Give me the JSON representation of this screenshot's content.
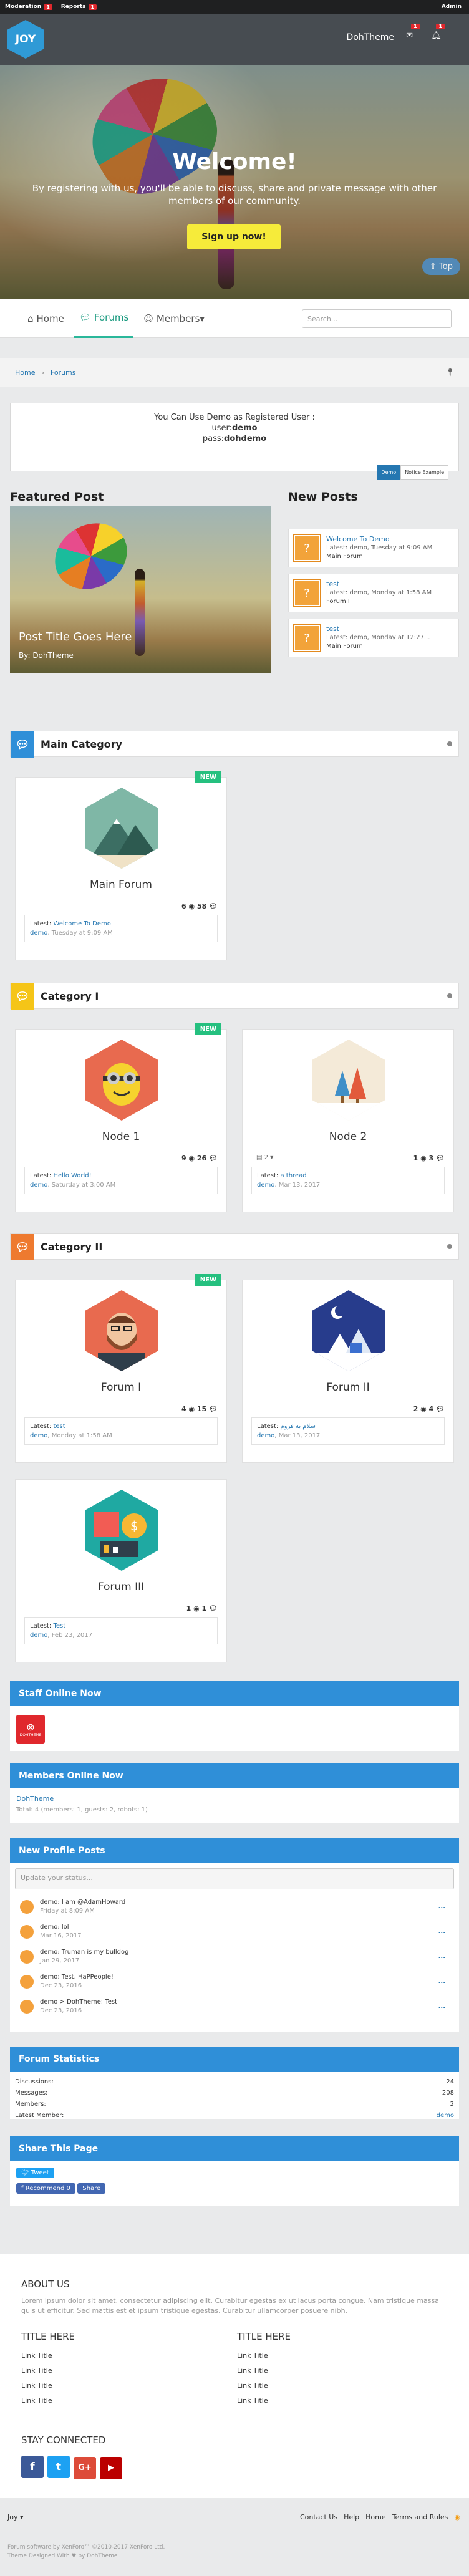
{
  "topbar": {
    "moderation": "Moderation",
    "moderation_count": "1",
    "reports": "Reports",
    "reports_count": "1",
    "admin": "Admin"
  },
  "header": {
    "logo": "JOY",
    "site_name": "DohTheme",
    "inbox_count": "1",
    "alerts_count": "1"
  },
  "hero": {
    "title": "Welcome!",
    "text": "By registering with us, you'll be able to discuss, share and private message with other members of our community.",
    "button": "Sign up now!",
    "top": "Top"
  },
  "nav": {
    "home": "Home",
    "forums": "Forums",
    "members": "Members",
    "search_placeholder": "Search..."
  },
  "breadcrumb": {
    "home": "Home",
    "forums": "Forums"
  },
  "notice": {
    "line1": "You Can Use Demo as Registered User :",
    "line2_label": "user:",
    "line2_value": "demo",
    "line3_label": "pass:",
    "line3_value": "dohdemo",
    "tag1": "Demo",
    "tag2": "Notice Example"
  },
  "featured": {
    "heading": "Featured Post",
    "title": "Post Title Goes Here",
    "author": "By: DohTheme"
  },
  "new_posts": {
    "heading": "New Posts",
    "items": [
      {
        "title": "Welcome To Demo",
        "latest": "Latest: demo, Tuesday at 9:09 AM",
        "forum": "Main Forum"
      },
      {
        "title": "test",
        "latest": "Latest: demo, Monday at 1:58 AM",
        "forum": "Forum I"
      },
      {
        "title": "test",
        "latest": "Latest: demo, Monday at 12:27...",
        "forum": "Main Forum"
      }
    ]
  },
  "categories": [
    {
      "name": "Main Category",
      "color": "#2f8fd8"
    },
    {
      "name": "Category I",
      "color": "#f5c518"
    },
    {
      "name": "Category II",
      "color": "#ee7a2f"
    }
  ],
  "forums": {
    "main": {
      "badge": "NEW",
      "name": "Main Forum",
      "threads": "6",
      "posts": "58",
      "latest_label": "Latest:",
      "latest_title": "Welcome To Demo",
      "user": "demo",
      "date": "Tuesday at 9:09 AM"
    },
    "node1": {
      "badge": "NEW",
      "name": "Node 1",
      "threads": "9",
      "posts": "26",
      "latest_label": "Latest:",
      "latest_title": "Hello World!",
      "user": "demo",
      "date": "Saturday at 3:00 AM"
    },
    "node2": {
      "name": "Node 2",
      "sub": "2",
      "threads": "1",
      "posts": "3",
      "latest_label": "Latest:",
      "latest_title": "a thread",
      "user": "demo",
      "date": "Mar 13, 2017"
    },
    "forum1": {
      "badge": "NEW",
      "name": "Forum I",
      "threads": "4",
      "posts": "15",
      "latest_label": "Latest:",
      "latest_title": "test",
      "user": "demo",
      "date": "Monday at 1:58 AM"
    },
    "forum2": {
      "name": "Forum II",
      "threads": "2",
      "posts": "4",
      "latest_label": "Latest:",
      "latest_title": "سلام به فروم",
      "user": "demo",
      "date": "Mar 13, 2017"
    },
    "forum3": {
      "name": "Forum III",
      "threads": "1",
      "posts": "1",
      "latest_label": "Latest:",
      "latest_title": "Test",
      "user": "demo",
      "date": "Feb 23, 2017"
    }
  },
  "staff_online": {
    "heading": "Staff Online Now",
    "avatar_label": "DOHTHEME"
  },
  "members_online": {
    "heading": "Members Online Now",
    "member": "DohTheme",
    "total": "Total: 4 (members: 1, guests: 2, robots: 1)"
  },
  "profile_posts": {
    "heading": "New Profile Posts",
    "placeholder": "Update your status...",
    "items": [
      {
        "text": "demo: I am @AdamHoward",
        "date": "Friday at 8:09 AM"
      },
      {
        "text": "demo: lol",
        "date": "Mar 16, 2017"
      },
      {
        "text": "demo: Truman is my bulldog",
        "date": "Jan 29, 2017"
      },
      {
        "text": "demo: Test, HaPPeople!",
        "date": "Dec 23, 2016"
      },
      {
        "text": "demo > DohTheme: Test",
        "date": "Dec 23, 2016"
      }
    ],
    "more": "..."
  },
  "stats": {
    "heading": "Forum Statistics",
    "rows": [
      {
        "label": "Discussions:",
        "value": "24"
      },
      {
        "label": "Messages:",
        "value": "208"
      },
      {
        "label": "Members:",
        "value": "2"
      },
      {
        "label": "Latest Member:",
        "value": "demo"
      }
    ]
  },
  "share": {
    "heading": "Share This Page",
    "tweet": "Tweet",
    "recommend": "Recommend 0",
    "share": "Share"
  },
  "footer": {
    "about_title": "ABOUT US",
    "about_text": "Lorem ipsum dolor sit amet, consectetur adipiscing elit. Curabitur egestas ex ut lacus porta congue. Nam tristique massa quis ut efficitur. Sed mattis est et ipsum tristique egestas. Curabitur ullamcorper posuere nibh.",
    "col1_title": "TITLE HERE",
    "col2_title": "TITLE HERE",
    "link": "Link Title",
    "connected": "STAY CONNECTED",
    "social": [
      "f",
      "t",
      "G+",
      "▶"
    ]
  },
  "bottom": {
    "style": "Joy",
    "links": [
      "Contact Us",
      "Help",
      "Home",
      "Terms and Rules"
    ],
    "copyright": "Forum software by XenForo™ ©2010-2017 XenForo Ltd.",
    "designed": "Theme Designed With ♥ by DohTheme"
  }
}
